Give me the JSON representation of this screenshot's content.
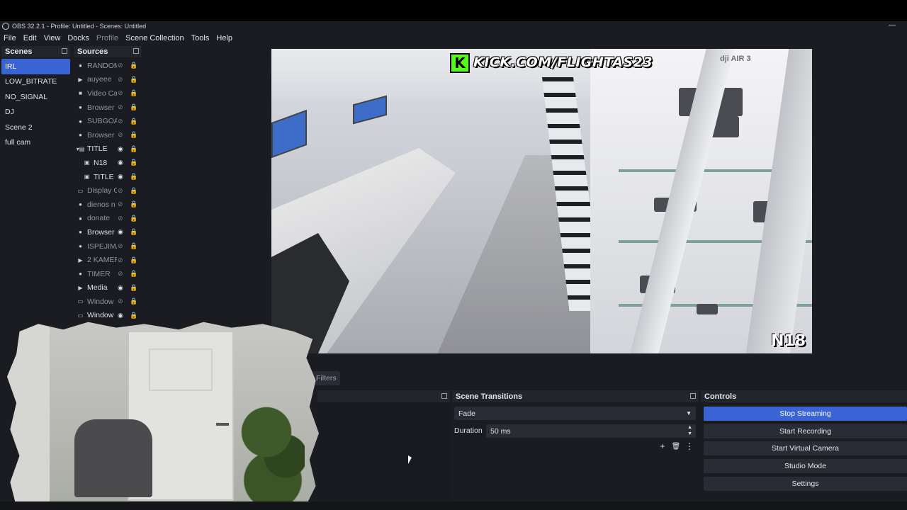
{
  "window": {
    "title": "OBS 32.2.1 - Profile: Untitled - Scenes: Untitled",
    "minimize": "—"
  },
  "menu": [
    "File",
    "Edit",
    "View",
    "Docks",
    "Profile",
    "Scene Collection",
    "Tools",
    "Help"
  ],
  "scenes": {
    "header": "Scenes",
    "items": [
      "IRL",
      "LOW_BITRATE",
      "NO_SIGNAL",
      "DJ",
      "Scene 2",
      "full cam"
    ],
    "selected": "IRL"
  },
  "sources": {
    "header": "Sources",
    "items": [
      {
        "label": "RANDOM",
        "icon": "globe-icon",
        "visible": false,
        "locked": false
      },
      {
        "label": "auyeee",
        "icon": "play-icon",
        "visible": false,
        "locked": false
      },
      {
        "label": "Video Ca",
        "icon": "camera-icon",
        "visible": false,
        "locked": false
      },
      {
        "label": "Browser",
        "icon": "globe-icon",
        "visible": false,
        "locked": false
      },
      {
        "label": "SUBGOA",
        "icon": "globe-icon",
        "visible": false,
        "locked": true
      },
      {
        "label": "Browser",
        "icon": "globe-icon",
        "visible": false,
        "locked": true
      },
      {
        "label": "TITLE",
        "icon": "folder-icon",
        "visible": true,
        "locked": true,
        "expanded": true
      },
      {
        "label": "N18",
        "icon": "image-icon",
        "visible": true,
        "locked": false,
        "indent": true
      },
      {
        "label": "TITLE",
        "icon": "image-icon",
        "visible": true,
        "locked": false,
        "indent": true
      },
      {
        "label": "Display C",
        "icon": "monitor-icon",
        "visible": false,
        "locked": true
      },
      {
        "label": "dienos n",
        "icon": "globe-icon",
        "visible": false,
        "locked": true
      },
      {
        "label": "donate",
        "icon": "globe-icon",
        "visible": false,
        "locked": true
      },
      {
        "label": "Browser",
        "icon": "globe-icon",
        "visible": true,
        "locked": true
      },
      {
        "label": "ISPEJIMA",
        "icon": "globe-icon",
        "visible": false,
        "locked": true
      },
      {
        "label": "2 KAMER",
        "icon": "play-icon",
        "visible": false,
        "locked": true
      },
      {
        "label": "TIMER",
        "icon": "globe-icon",
        "visible": false,
        "locked": true
      },
      {
        "label": "Media",
        "icon": "play-icon",
        "visible": true,
        "locked": false
      },
      {
        "label": "Window",
        "icon": "window-icon",
        "visible": false,
        "locked": true
      },
      {
        "label": "Window",
        "icon": "window-icon",
        "visible": true,
        "locked": true
      }
    ]
  },
  "preview": {
    "overlay_url": "KICK.COM/FLIGHTAS23",
    "overlay_k": "K",
    "badge": "N18",
    "product_text": "dji AIR 3"
  },
  "filters_button": "Filters",
  "transitions": {
    "header": "Scene Transitions",
    "selected": "Fade",
    "duration_label": "Duration",
    "duration_value": "50 ms"
  },
  "controls": {
    "header": "Controls",
    "buttons": [
      "Stop Streaming",
      "Start Recording",
      "Start Virtual Camera",
      "Studio Mode",
      "Settings"
    ]
  },
  "colors": {
    "accent": "#3a63d6",
    "kick_green": "#53fc18",
    "panel_bg": "#1b1c22"
  }
}
